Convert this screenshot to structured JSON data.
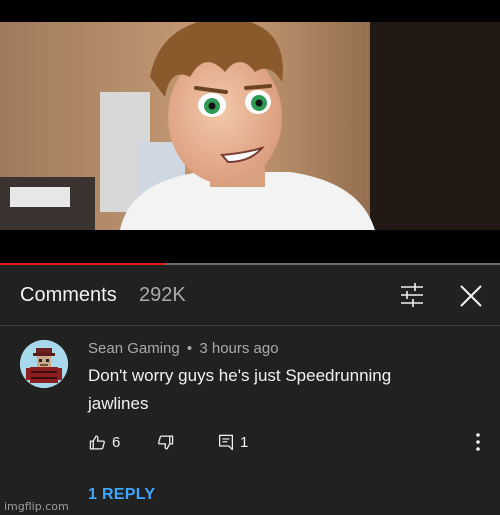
{
  "video": {
    "progress_fraction": 0.33,
    "progress_color": "#e01a16"
  },
  "comments_header": {
    "title": "Comments",
    "count": "292K",
    "filter_icon": "sliders-icon",
    "close_icon": "close-icon"
  },
  "comment": {
    "author": "Sean Gaming",
    "separator": "•",
    "time": "3 hours ago",
    "text": "Don't worry guys he's just Speedrunning jawlines",
    "like_count": "6",
    "reply_count": "1",
    "reply_link": "1 REPLY",
    "avatar_icon": "user-avatar",
    "like_icon": "thumbs-up-icon",
    "dislike_icon": "thumbs-down-icon",
    "reply_icon": "comment-icon",
    "menu_icon": "more-vertical-icon"
  },
  "watermark": "imgflip.com",
  "colors": {
    "background": "#212121",
    "link": "#3ea6ff",
    "muted": "#aaaaaa"
  }
}
